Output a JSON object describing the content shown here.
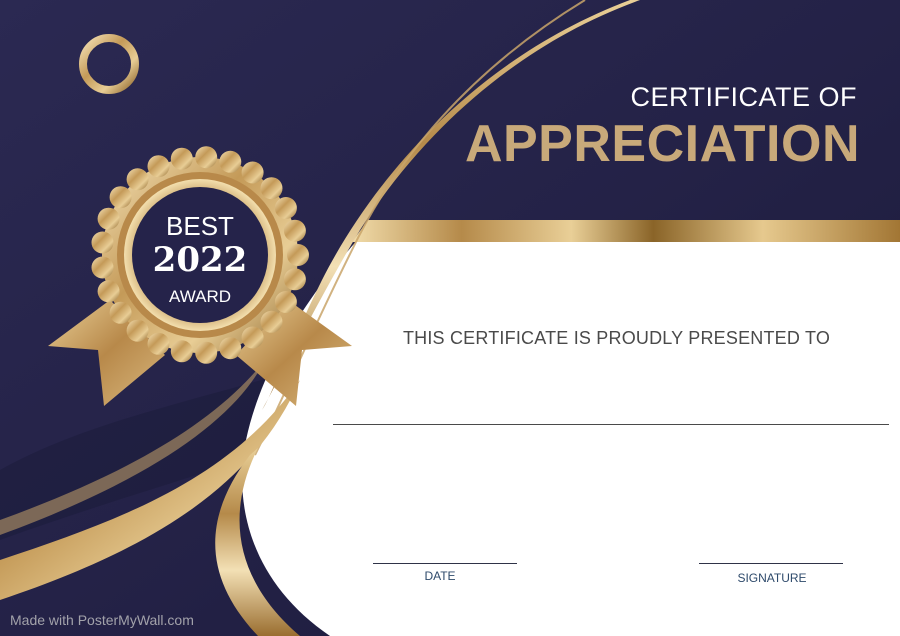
{
  "certificate": {
    "heading_line1": "CERTIFICATE OF",
    "heading_line2": "APPRECIATION",
    "presented_text": "THIS CERTIFICATE IS PROUDLY PRESENTED TO",
    "date_label": "DATE",
    "signature_label": "SIGNATURE"
  },
  "badge": {
    "line1": "BEST",
    "year": "2022",
    "line3": "AWARD"
  },
  "watermark": "Made with PosterMyWall.com",
  "colors": {
    "navy": "#232145",
    "gold": "#c8a97a",
    "gold_dark": "#a67c3d",
    "text_gray": "#4a4a4a",
    "label_blue": "#2e4a6b"
  }
}
